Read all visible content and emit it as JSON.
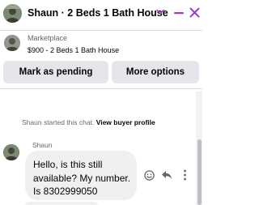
{
  "header": {
    "title": "Shaun · 2 Beds 1 Bath House",
    "icons": [
      "user-avatar",
      "chevron-down-icon",
      "minimize-icon",
      "close-icon"
    ],
    "accent_color": "#a33bc2"
  },
  "listing": {
    "source": "Marketplace",
    "title": "$900 - 2 Beds 1 Bath House"
  },
  "actions": {
    "mark_pending": "Mark as pending",
    "more_options": "More options"
  },
  "chat": {
    "system_prefix": "Shaun started this chat.",
    "system_link": "View buyer profile",
    "sender": "Shaun",
    "message_lines": [
      "Hello, is this still",
      "available? My number.",
      "Is 8302999050"
    ],
    "message_action_icons": [
      "emoji-icon",
      "reply-icon",
      "more-vertical-icon"
    ]
  }
}
